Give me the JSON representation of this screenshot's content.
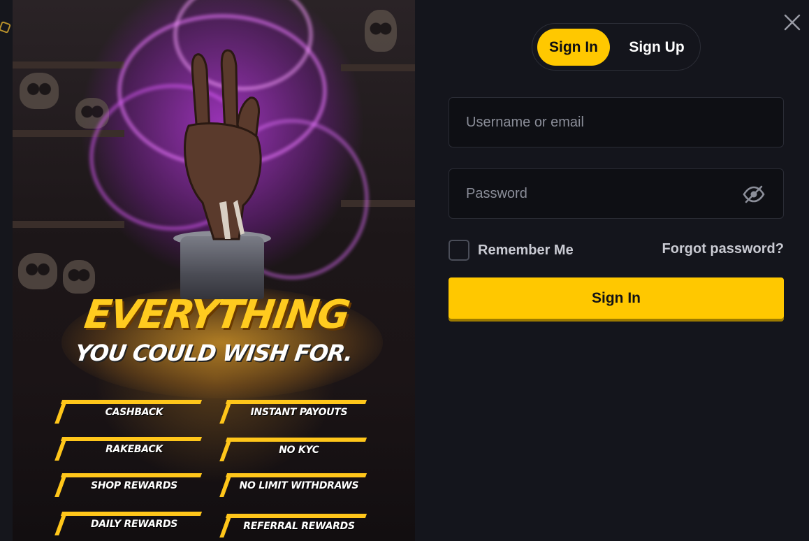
{
  "promo": {
    "headline": "EVERYTHING",
    "subheadline": "YOU COULD WISH FOR.",
    "perks": [
      "CASHBACK",
      "INSTANT PAYOUTS",
      "RAKEBACK",
      "NO KYC",
      "SHOP REWARDS",
      "NO LIMIT WITHDRAWS",
      "DAILY REWARDS",
      "REFERRAL REWARDS"
    ]
  },
  "auth": {
    "tabs": {
      "sign_in": "Sign In",
      "sign_up": "Sign Up",
      "active": "sign_in"
    },
    "username_placeholder": "Username or email",
    "password_placeholder": "Password",
    "remember_label": "Remember Me",
    "forgot_label": "Forgot password?",
    "submit_label": "Sign In"
  },
  "icons": {
    "close": "close-icon",
    "password_visibility": "eye-slash-icon",
    "backdrop": "logo-icon"
  },
  "colors": {
    "accent": "#ffc800",
    "background": "#14151c",
    "field": "#0e0f14",
    "smoke": "#c040e0"
  }
}
